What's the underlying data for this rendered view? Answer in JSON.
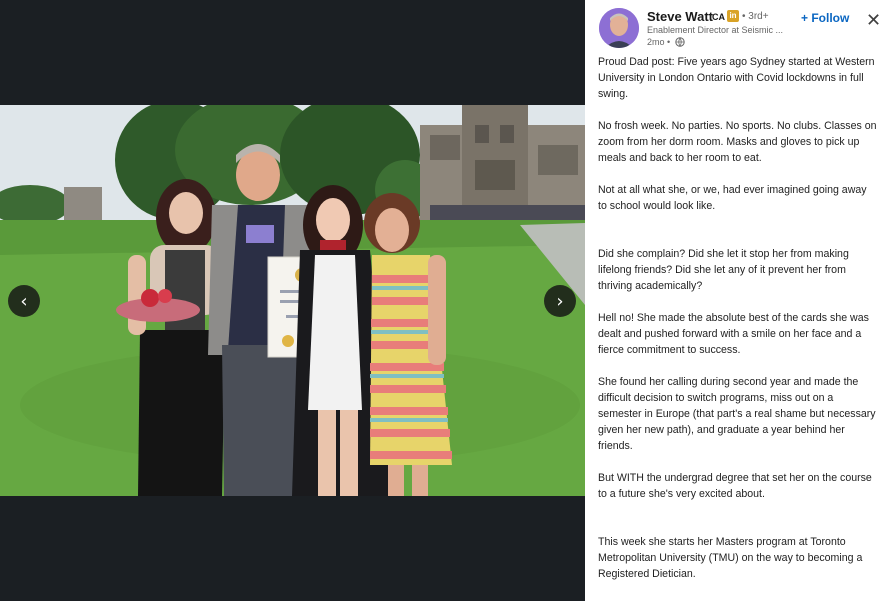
{
  "post": {
    "author": {
      "name": "Steve Watt",
      "credential": "CA",
      "badge": "in",
      "degree": "• 3rd+",
      "headline": "Enablement Director at Seismic ...",
      "timestamp": "2mo •"
    },
    "actions": {
      "follow_label": "+ Follow",
      "close_glyph": "✕"
    },
    "paragraphs": [
      "Proud Dad post: Five years ago Sydney started at Western University in London Ontario with Covid lockdowns in full swing.",
      "No frosh week. No parties. No sports. No clubs. Classes on zoom from her dorm room. Masks and gloves to pick up meals and back to her room to eat.",
      "Not at all what she, or we, had ever imagined going away to school would look like.",
      "Did she complain? Did she let it stop her from making lifelong friends? Did she let any of it prevent her from thriving academically?",
      "Hell no! She made the absolute best of the cards she was dealt and pushed forward with a smile on her face and a fierce commitment to success.",
      "She found her calling during second year and made the difficult decision to switch programs, miss out on a semester in Europe (that part's a real shame but necessary given her new path), and graduate a year behind her friends.",
      "But WITH the undergrad degree that set her on the course to a future she's very excited about.",
      "This week she starts her Masters program at Toronto Metropolitan University (TMU) on the way to becoming a Registered Dietician."
    ]
  },
  "media": {
    "prev_glyph": "‹",
    "next_glyph": "›"
  }
}
